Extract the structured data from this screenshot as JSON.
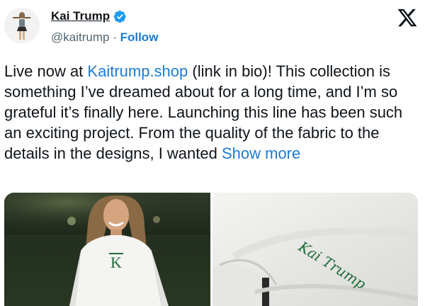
{
  "author": {
    "display_name": "Kai Trump",
    "handle": "@kaitrump",
    "separator": "·",
    "follow_label": "Follow"
  },
  "tweet": {
    "text_before": "Live now at ",
    "link_text": "Kaitrump.shop",
    "text_after": " (link in bio)! This collection is something I’ve dreamed about for a long time, and I’m so grateful it’s finally here. Launching this line has been such an exciting project. From the quality of the fabric to the details in the designs, I wanted ",
    "show_more": "Show more"
  },
  "media": {
    "left_logo_text": "K",
    "right_script_text": "Kai Trump"
  },
  "colors": {
    "link": "#1d7bd0",
    "verified": "#1d9bf0",
    "text": "#0f1419",
    "secondary": "#536471",
    "embroidery": "#1f6b3a"
  }
}
